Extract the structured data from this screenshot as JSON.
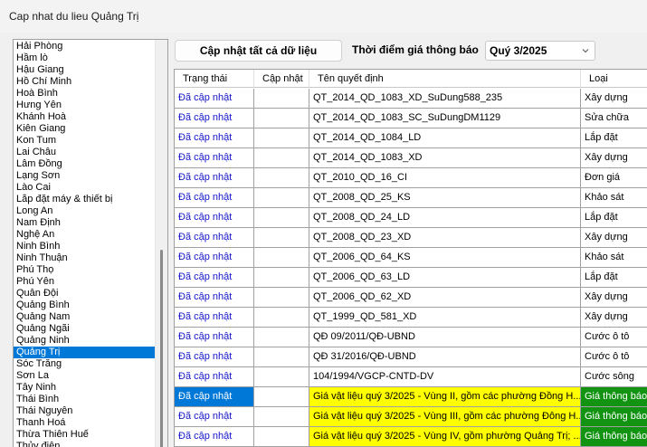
{
  "window": {
    "title": "Cap nhat du lieu Quảng Trị"
  },
  "provinces": [
    "Hải Phòng",
    "Hầm lò",
    "Hậu Giang",
    "Hồ Chí Minh",
    "Hoà Bình",
    "Hưng Yên",
    "Khánh Hoà",
    "Kiên Giang",
    "Kon Tum",
    "Lai Châu",
    "Lâm Đồng",
    "Lạng Sơn",
    "Lào Cai",
    "Lắp đặt máy & thiết bị",
    "Long An",
    "Nam Định",
    "Nghệ An",
    "Ninh Bình",
    "Ninh Thuận",
    "Phú Thọ",
    "Phú Yên",
    "Quân Đội",
    "Quảng Bình",
    "Quảng Nam",
    "Quảng Ngãi",
    "Quảng Ninh",
    "Quảng Trị",
    "Sóc Trăng",
    "Sơn La",
    "Tây Ninh",
    "Thái Bình",
    "Thái Nguyên",
    "Thanh Hoá",
    "Thừa Thiên Huế",
    "Thủy điện"
  ],
  "selected_province_index": 26,
  "toolbar": {
    "update_all_label": "Cập nhật tất cả dữ liệu",
    "period_label": "Thời điểm giá thông báo",
    "period_value": "Quý 3/2025"
  },
  "grid": {
    "columns": [
      "Trạng thái",
      "Cập nhật",
      "Tên quyết định",
      "Loại"
    ],
    "rows": [
      {
        "status": "Đã cập nhật",
        "update": "",
        "name": "QT_2014_QD_1083_XD_SuDung588_235",
        "type": "Xây dựng",
        "highlight": false
      },
      {
        "status": "Đã cập nhật",
        "update": "",
        "name": "QT_2014_QD_1083_SC_SuDungDM1129",
        "type": "Sửa chữa",
        "highlight": false
      },
      {
        "status": "Đã cập nhật",
        "update": "",
        "name": "QT_2014_QD_1084_LD",
        "type": "Lắp đặt",
        "highlight": false
      },
      {
        "status": "Đã cập nhật",
        "update": "",
        "name": "QT_2014_QD_1083_XD",
        "type": "Xây dựng",
        "highlight": false
      },
      {
        "status": "Đã cập nhật",
        "update": "",
        "name": "QT_2010_QD_16_CI",
        "type": "Đơn giá",
        "highlight": false
      },
      {
        "status": "Đã cập nhật",
        "update": "",
        "name": "QT_2008_QD_25_KS",
        "type": "Khảo sát",
        "highlight": false
      },
      {
        "status": "Đã cập nhật",
        "update": "",
        "name": "QT_2008_QD_24_LD",
        "type": "Lắp đặt",
        "highlight": false
      },
      {
        "status": "Đã cập nhật",
        "update": "",
        "name": "QT_2008_QD_23_XD",
        "type": "Xây dựng",
        "highlight": false
      },
      {
        "status": "Đã cập nhật",
        "update": "",
        "name": "QT_2006_QD_64_KS",
        "type": "Khảo sát",
        "highlight": false
      },
      {
        "status": "Đã cập nhật",
        "update": "",
        "name": "QT_2006_QD_63_LD",
        "type": "Lắp đặt",
        "highlight": false
      },
      {
        "status": "Đã cập nhật",
        "update": "",
        "name": "QT_2006_QD_62_XD",
        "type": "Xây dựng",
        "highlight": false
      },
      {
        "status": "Đã cập nhật",
        "update": "",
        "name": "QT_1999_QD_581_XD",
        "type": "Xây dựng",
        "highlight": false
      },
      {
        "status": "Đã cập nhật",
        "update": "",
        "name": "QĐ 09/2011/QĐ-UBND",
        "type": "Cước ô tô",
        "highlight": false
      },
      {
        "status": "Đã cập nhật",
        "update": "",
        "name": "QĐ 31/2016/QĐ-UBND",
        "type": "Cước ô tô",
        "highlight": false
      },
      {
        "status": "Đã cập nhật",
        "update": "",
        "name": "104/1994/VGCP-CNTD-DV",
        "type": "Cước sông",
        "highlight": false
      },
      {
        "status": "Đã cập nhật",
        "update": "",
        "name": "Giá vật liệu quý 3/2025 - Vùng II, gồm các phường Đồng H...",
        "type": "Giá thông báo",
        "highlight": true,
        "current": true
      },
      {
        "status": "Đã cập nhật",
        "update": "",
        "name": "Giá vật liệu quý 3/2025 - Vùng III, gồm các phường Đông H...",
        "type": "Giá thông báo",
        "highlight": true
      },
      {
        "status": "Đã cập nhật",
        "update": "",
        "name": "Giá vật liệu quý 3/2025 - Vùng IV, gồm phường Quảng Trị; ...",
        "type": "Giá thông báo",
        "highlight": true
      }
    ]
  }
}
